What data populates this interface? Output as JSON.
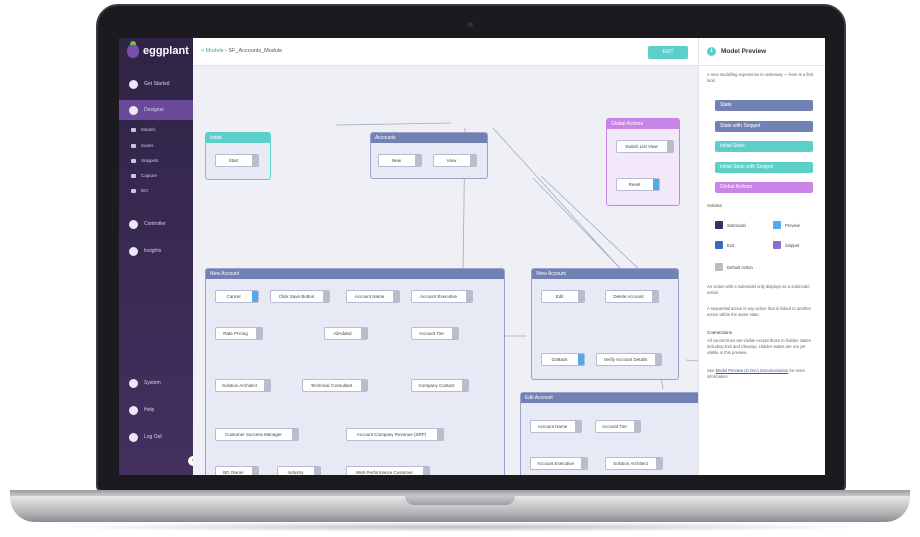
{
  "app": {
    "name": "eggplant"
  },
  "sidebar": {
    "items": [
      {
        "label": "Get Started",
        "icon": "compass-icon"
      },
      {
        "label": "Designer",
        "icon": "designer-icon"
      },
      {
        "label": "Controller",
        "icon": "play-icon"
      },
      {
        "label": "Insights",
        "icon": "chart-icon"
      },
      {
        "label": "System",
        "icon": "gear-icon"
      },
      {
        "label": "Help",
        "icon": "help-icon"
      },
      {
        "label": "Log Out",
        "icon": "logout-icon"
      }
    ],
    "sub_items": [
      {
        "label": "Models"
      },
      {
        "label": "Suites"
      },
      {
        "label": "Snippets"
      },
      {
        "label": "Capture"
      },
      {
        "label": "BCI"
      }
    ]
  },
  "header": {
    "back_label": "< Models",
    "title": "› SF_Accounts_Module",
    "exit_label": "EXIT"
  },
  "states": {
    "initial": {
      "title": "Initial",
      "actions": [
        "Start"
      ]
    },
    "accounts": {
      "title": "Accounts",
      "actions": [
        "New",
        "View"
      ]
    },
    "global": {
      "title": "Global Actions",
      "actions": [
        "Switch List View",
        "Reset"
      ]
    },
    "new_account": {
      "title": "New Account",
      "actions": [
        "Cancel",
        "Click Save Button",
        "Account Name",
        "Account Executive",
        "Rate Pricing",
        "AllAdded",
        "Account Tier",
        "Solution Architect",
        "Technical Consultant",
        "Company Contact",
        "Customer Success Manager",
        "Account Company Revenue (SRP)",
        "BD Owner",
        "Industry",
        "Web Performance Customer"
      ]
    },
    "view_account": {
      "title": "View Account",
      "actions": [
        "Edit",
        "Delete Account",
        "GoBack",
        "Verify Account Details"
      ]
    },
    "edit_account": {
      "title": "Edit Account",
      "actions": [
        "Account Name",
        "Account Tier",
        "Account Executive",
        "Solution Architect"
      ]
    }
  },
  "panel": {
    "title": "Model Preview",
    "intro": "A new modelling experience is underway — here is a first look.",
    "legend": [
      {
        "label": "State",
        "color": "#7181b4"
      },
      {
        "label": "State with Snippet",
        "color": "#7181b4"
      },
      {
        "label": "Initial State",
        "color": "#5ccfc9"
      },
      {
        "label": "Initial State with Snippet",
        "color": "#5ccfc9"
      },
      {
        "label": "Global Actions",
        "color": "#c884e6"
      }
    ],
    "actions_title": "Actions",
    "action_types": [
      {
        "label": "Submodel",
        "color": "#3b2e6e"
      },
      {
        "label": "Preview",
        "color": "#57a8e8"
      },
      {
        "label": "Exit",
        "color": "#3b66c6"
      },
      {
        "label": "Snippet",
        "color": "#8a6fd1"
      },
      {
        "label": "Default Action",
        "color": "#b9bdc9"
      }
    ],
    "note1": "An action with a submodel only displays as a submodel action.",
    "note2": "A sequential action is any action that is linked to another action within the same state.",
    "connections_title": "Connections",
    "note3": "All connections are visible except those to hidden states including Exit and Cleanup. Hidden states are not yet visible in this preview.",
    "see_prefix": "See ",
    "link_text": "Model Preview (in Dev) Documentation",
    "see_suffix": " for more information."
  }
}
